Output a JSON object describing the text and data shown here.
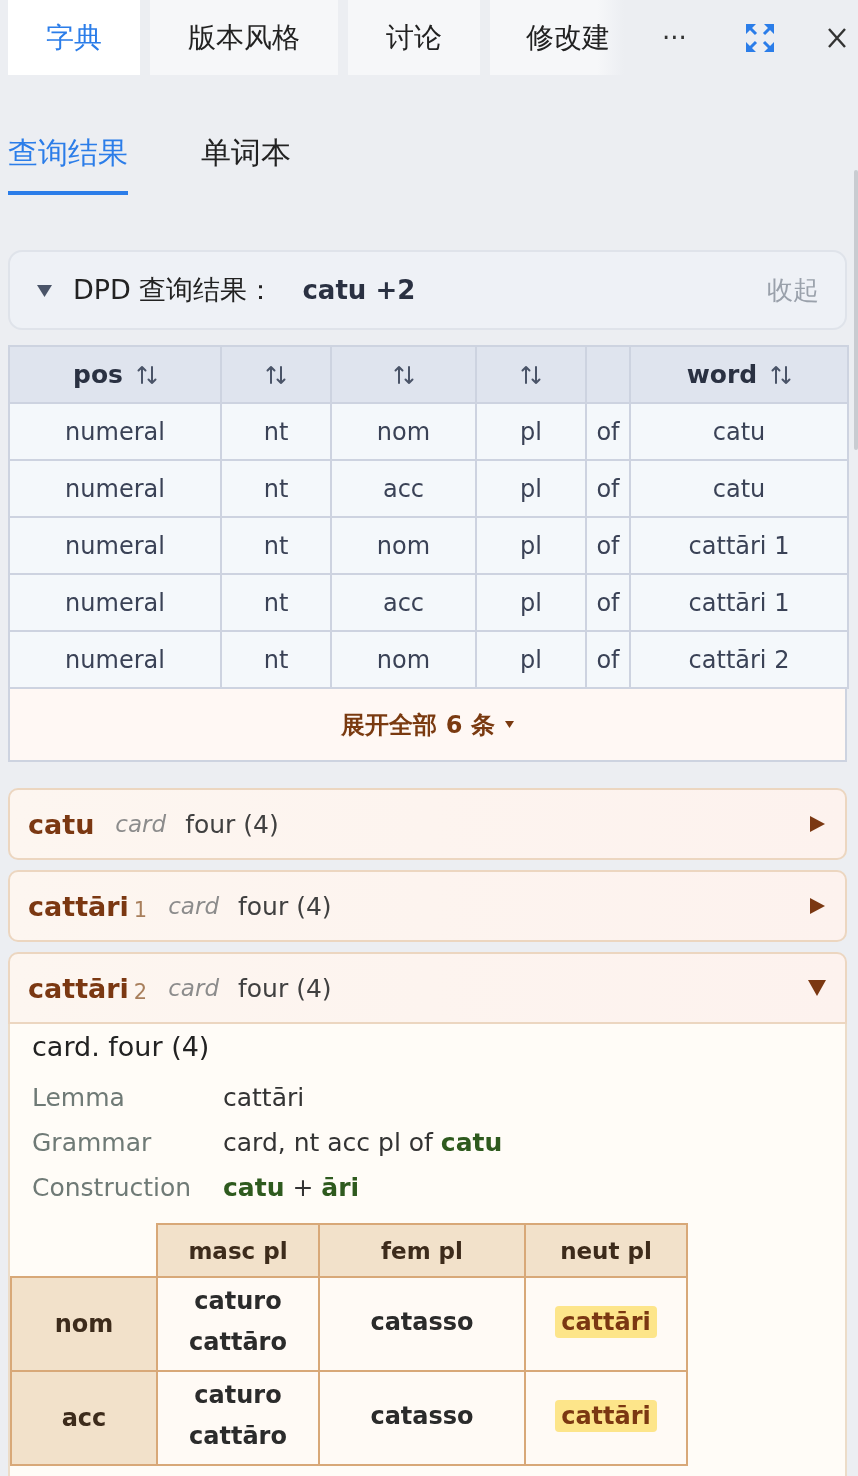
{
  "top_tabs": [
    {
      "label": "字典",
      "selected": true
    },
    {
      "label": "版本风格",
      "selected": false
    },
    {
      "label": "讨论",
      "selected": false
    },
    {
      "label": "修改建",
      "selected": false
    }
  ],
  "toolbar": {
    "more_label": "···"
  },
  "sub_tabs": [
    {
      "label": "查询结果",
      "selected": true
    },
    {
      "label": "单词本",
      "selected": false
    }
  ],
  "result_panel": {
    "expanded": true,
    "title": "DPD 查询结果：",
    "query": "catu +2",
    "collapse_label": "收起"
  },
  "results_table": {
    "columns": [
      {
        "label": "pos",
        "sortable": true
      },
      {
        "sortable": true
      },
      {
        "sortable": true
      },
      {
        "sortable": true
      },
      {},
      {
        "label": "word",
        "sortable": true
      }
    ],
    "rows": [
      [
        "numeral",
        "nt",
        "nom",
        "pl",
        "of",
        "catu"
      ],
      [
        "numeral",
        "nt",
        "acc",
        "pl",
        "of",
        "catu"
      ],
      [
        "numeral",
        "nt",
        "nom",
        "pl",
        "of",
        "cattāri 1"
      ],
      [
        "numeral",
        "nt",
        "acc",
        "pl",
        "of",
        "cattāri 1"
      ],
      [
        "numeral",
        "nt",
        "nom",
        "pl",
        "of",
        "cattāri 2"
      ]
    ],
    "expand_all": "展开全部 6 条"
  },
  "entries": [
    {
      "headword": "catu",
      "pos": "card",
      "meaning": "four (4)",
      "expanded": false
    },
    {
      "headword": "cattāri",
      "number": "1",
      "pos": "card",
      "meaning": "four (4)",
      "expanded": false
    },
    {
      "headword": "cattāri",
      "number": "2",
      "pos": "card",
      "meaning": "four (4)",
      "expanded": true,
      "detail": {
        "summary": "card. four (4)",
        "fields": [
          {
            "label": "Lemma",
            "value": "cattāri"
          },
          {
            "label": "Grammar",
            "value": "card, nt acc pl of **catu**"
          },
          {
            "label": "Construction",
            "value": "**catu** + **āri**"
          }
        ],
        "declension": {
          "columns": [
            "masc pl",
            "fem pl",
            "neut pl"
          ],
          "rows": [
            {
              "case": "nom",
              "cells": [
                {
                  "forms": [
                    "caturo",
                    "cattāro"
                  ],
                  "highlighted": false
                },
                {
                  "forms": [
                    "catasso"
                  ],
                  "highlighted": false
                },
                {
                  "forms": [
                    "cattāri"
                  ],
                  "highlighted": true
                }
              ]
            },
            {
              "case": "acc",
              "cells": [
                {
                  "forms": [
                    "caturo",
                    "cattāro"
                  ],
                  "highlighted": false
                },
                {
                  "forms": [
                    "catasso"
                  ],
                  "highlighted": false
                },
                {
                  "forms": [
                    "cattāri"
                  ],
                  "highlighted": true
                }
              ]
            }
          ]
        }
      }
    }
  ]
}
